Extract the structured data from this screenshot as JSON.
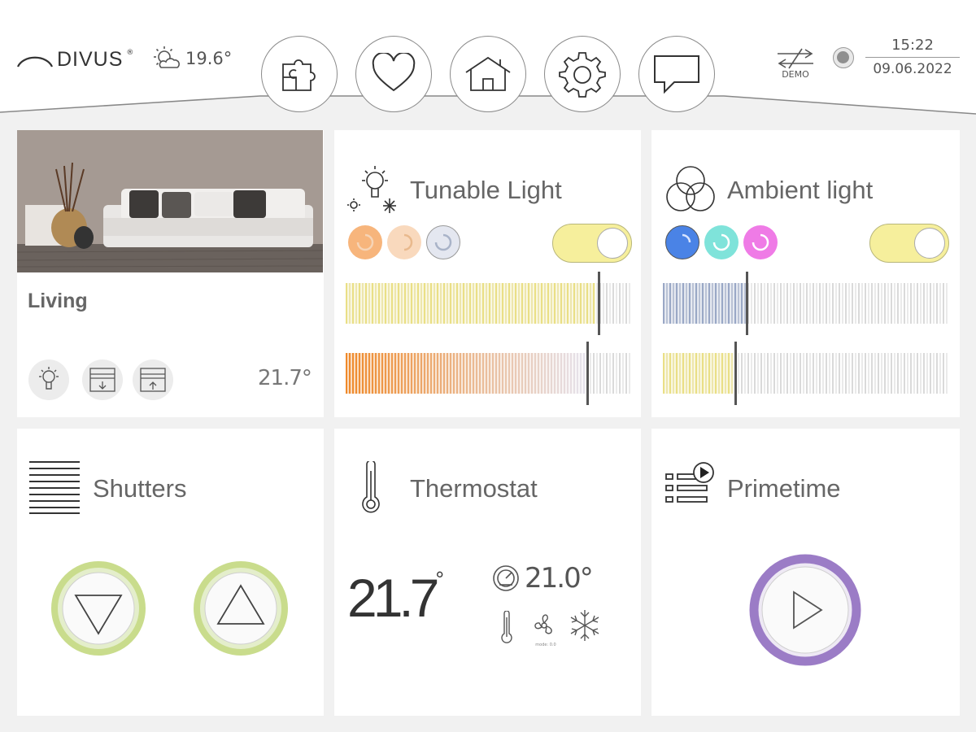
{
  "header": {
    "brand": "DIVUS",
    "brand_mark": "®",
    "weather_temp": "19.6°",
    "demo_label": "DEMO",
    "time": "15:22",
    "date": "09.06.2022",
    "nav_icons": [
      "puzzle-icon",
      "heart-icon",
      "home-icon",
      "gear-icon",
      "chat-icon"
    ]
  },
  "living": {
    "name": "Living",
    "temperature": "21.7°",
    "icons": [
      "lightbulb-icon",
      "shutter-down-icon",
      "shutter-up-icon"
    ]
  },
  "tunable_light": {
    "title": "Tunable Light",
    "swatch_colors": [
      "#f7b57c",
      "#f9d9bd",
      "#e4e7f0"
    ],
    "toggle_on": true,
    "brightness_level": 0.88,
    "color_temp_level": 0.84,
    "brightness_color": "#eadf86",
    "warm_color": "#ef8a2b"
  },
  "ambient_light": {
    "title": "Ambient light",
    "swatch_colors": [
      "#4a83e6",
      "#7fe3da",
      "#ef7be6"
    ],
    "toggle_on": true,
    "level_1": 0.29,
    "level_2": 0.25,
    "level_1_color": "#9aa8c6",
    "level_2_color": "#eadf86"
  },
  "shutters": {
    "title": "Shutters",
    "accent": "#c9dc8c"
  },
  "thermostat": {
    "title": "Thermostat",
    "current_temp": "21.7",
    "current_unit": "°",
    "setpoint": "21.0°",
    "mode_caption": "mode: 0.0"
  },
  "primetime": {
    "title": "Primetime",
    "accent": "#9b7cc6"
  }
}
